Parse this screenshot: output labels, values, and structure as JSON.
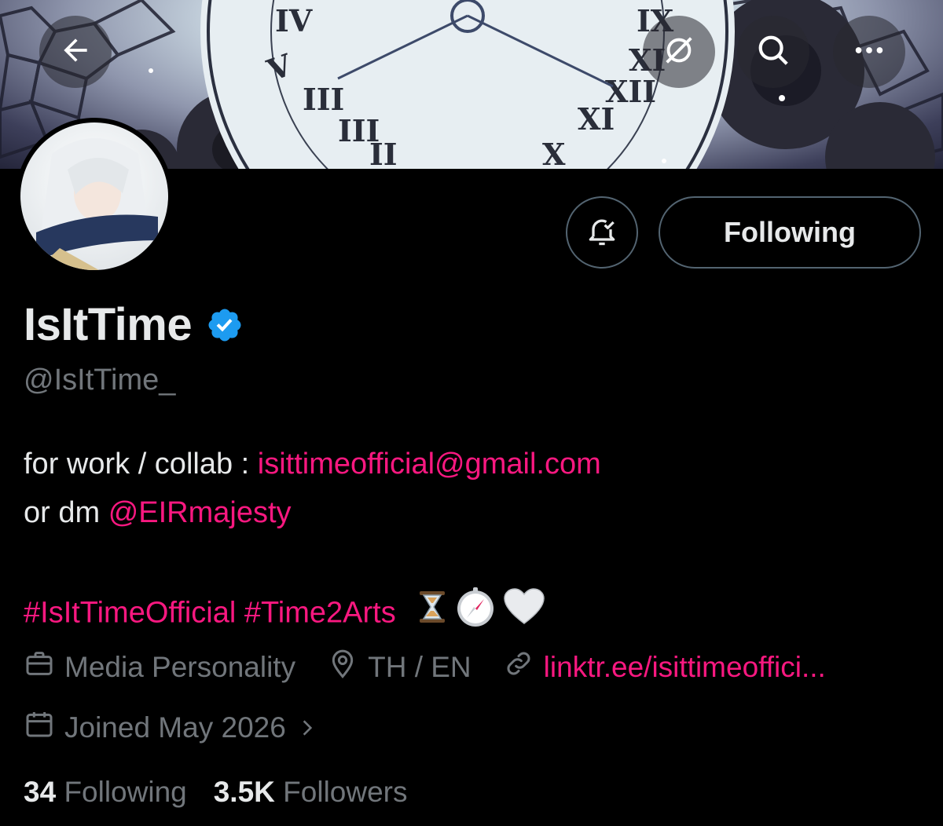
{
  "header": {
    "back_icon": "arrow-left-icon",
    "grok_icon": "grok-icon",
    "search_icon": "search-icon",
    "more_icon": "more-horizontal-icon"
  },
  "profile": {
    "display_name": "IsItTime",
    "handle": "@IsItTime_",
    "verified": true,
    "bell_icon": "notification-bell-check-icon",
    "following_button_label": "Following"
  },
  "bio": {
    "line1_prefix": "for work / collab : ",
    "email": "isittimeofficial@gmail.com",
    "line2_prefix": "or dm ",
    "mention": "@EIRmajesty",
    "hashtag1": "#IsItTimeOfficial",
    "hashtag2": "#Time2Arts",
    "emojis": [
      "hourglass-emoji",
      "compass-emoji",
      "white-heart-emoji"
    ]
  },
  "meta": {
    "category": "Media Personality",
    "location": "TH / EN",
    "link": "linktr.ee/isittimeoffici...",
    "joined": "Joined May 2026"
  },
  "stats": {
    "following_count": "34",
    "following_label": "Following",
    "followers_count": "3.5K",
    "followers_label": "Followers"
  },
  "colors": {
    "background": "#000000",
    "accent_pink": "#f91880",
    "verified_blue": "#1d9bf0",
    "muted_text": "#71767b",
    "border": "#536471"
  }
}
